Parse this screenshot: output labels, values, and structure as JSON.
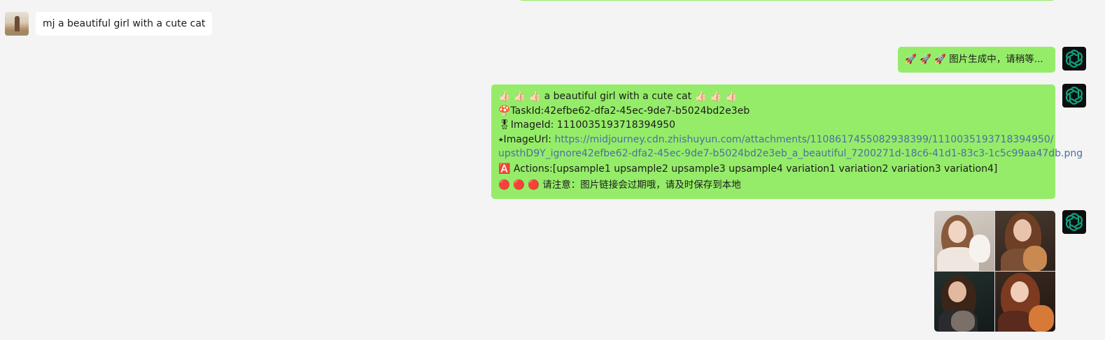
{
  "messages": {
    "user_prompt": "mj a beautiful girl with a cute cat",
    "generating": "🚀 🚀 🚀 图片生成中，请稍等...",
    "result": {
      "title_line": "👍🏻 👍🏻 👍🏻 a beautiful girl with a cute cat 👍🏻 👍🏻 👍🏻",
      "task_id_line": "🍄TaskId:42efbe62-dfa2-45ec-9de7-b5024bd2e3eb",
      "image_id_line": "🎖ImageId: 1110035193718394950",
      "image_url_label": "⭑ImageUrl: ",
      "image_url_line1": "https://midjourney.cdn.zhishuyun.com/attachments/1108617455082938399/1110035193718394950/",
      "image_url_line2": "upsthD9Y_ignore42efbe62-dfa2-45ec-9de7-b5024bd2e3eb_a_beautiful_7200271d-18c6-41d1-83c3-1c5c99aa47db.png",
      "actions_line": "🅰️ Actions:[upsample1 upsample2 upsample3 upsample4 variation1 variation2 variation3 variation4]",
      "warning_line": "🔴 🔴 🔴 请注意：图片链接会过期哦，请及时保存到本地"
    }
  },
  "colors": {
    "background": "#f4f4f4",
    "bubble_green": "#95ec69",
    "bubble_white": "#ffffff",
    "link": "#4b6fa3",
    "bot_avatar_bg": "#0e0e0e",
    "bot_logo": "#10a37f"
  },
  "icons": {
    "bot_avatar": "openai-logo-icon",
    "user_avatar": "user-photo"
  }
}
